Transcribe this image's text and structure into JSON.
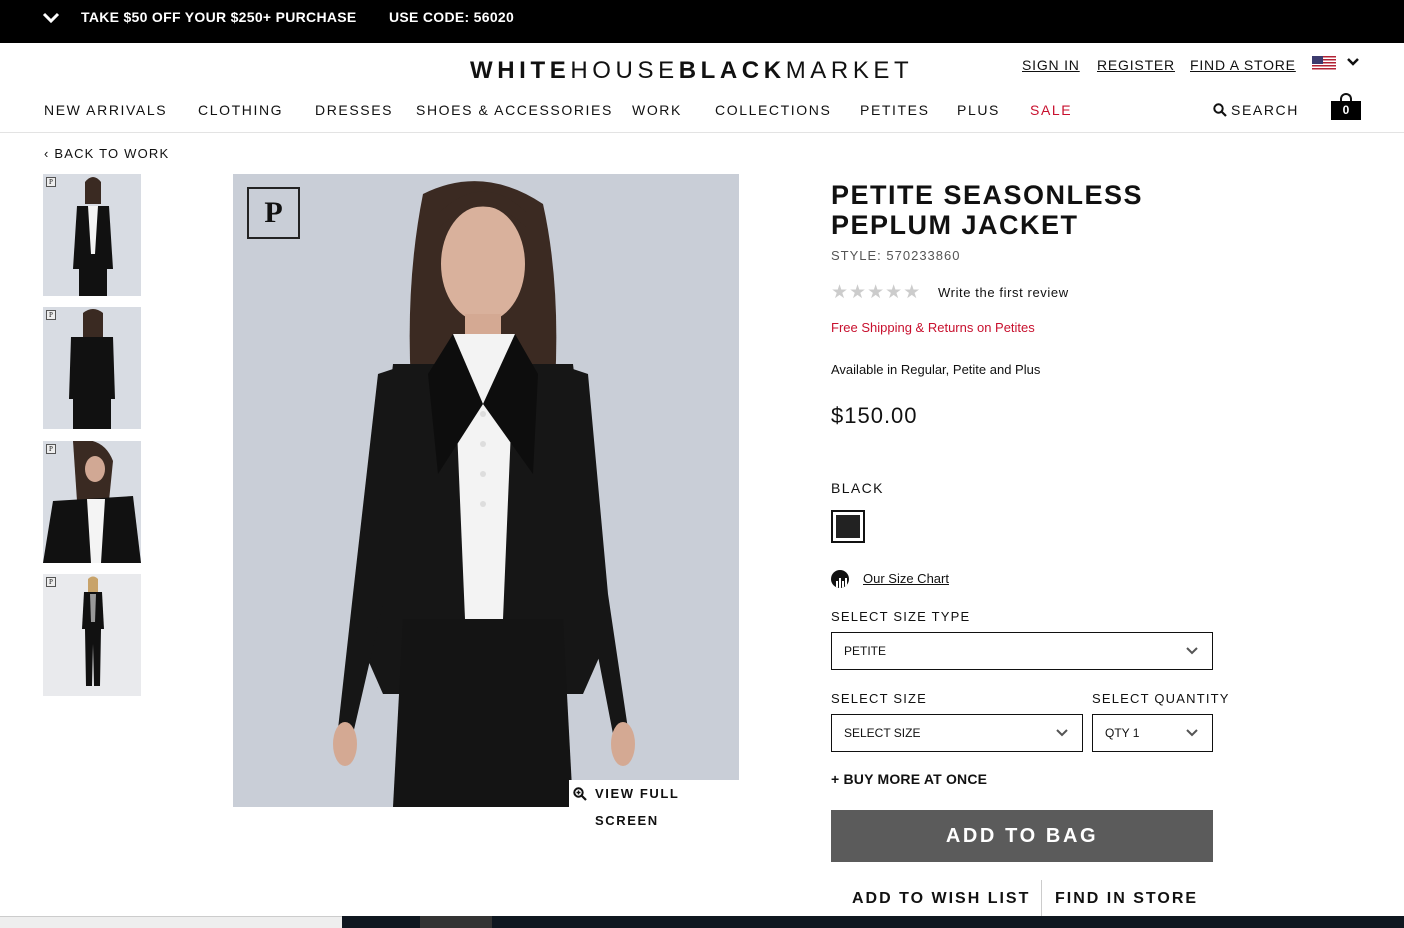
{
  "promo": {
    "offer": "TAKE $50 OFF YOUR $250+ PURCHASE",
    "code": "USE CODE: 56020",
    "toggle_icon": "chevron-down-icon"
  },
  "header": {
    "logo_white": "WHITE",
    "logo_house": "HOUSE",
    "logo_black": "BLACK",
    "logo_market": "MARKET",
    "sign_in": "SIGN IN",
    "register": "REGISTER",
    "find_store": "FIND A STORE",
    "country_icon": "us-flag-icon",
    "search": "SEARCH",
    "bag_count": "0"
  },
  "nav": [
    {
      "label": "NEW ARRIVALS"
    },
    {
      "label": "CLOTHING"
    },
    {
      "label": "DRESSES"
    },
    {
      "label": "SHOES & ACCESSORIES"
    },
    {
      "label": "WORK"
    },
    {
      "label": "COLLECTIONS"
    },
    {
      "label": "PETITES"
    },
    {
      "label": "PLUS"
    },
    {
      "label": "SALE",
      "color": "#c8102e"
    }
  ],
  "breadcrumb": {
    "back": "BACK TO WORK"
  },
  "gallery": {
    "badge": "P",
    "view_full_screen": "VIEW FULL SCREEN",
    "thumbnails": [
      {
        "badge": "P"
      },
      {
        "badge": "P"
      },
      {
        "badge": "P"
      },
      {
        "badge": "P"
      }
    ]
  },
  "product": {
    "title": "PETITE SEASONLESS PEPLUM JACKET",
    "style": "STYLE: 570233860",
    "rating": 0,
    "rating_max": 5,
    "review_link": "Write the first review",
    "free_shipping": "Free Shipping & Returns on Petites",
    "availability": "Available in Regular, Petite and Plus",
    "price": "$150.00",
    "color_name": "BLACK",
    "swatch_color": "#222222",
    "size_chart": "Our Size Chart",
    "size_type_label": "SELECT SIZE TYPE",
    "size_type_value": "PETITE",
    "size_label": "SELECT SIZE",
    "size_value": "SELECT SIZE",
    "quantity_label": "SELECT QUANTITY",
    "quantity_value": "QTY 1",
    "buy_more": "+ BUY MORE AT ONCE",
    "add_to_bag": "ADD TO BAG",
    "add_to_wish_list": "ADD TO WISH LIST",
    "find_in_store": "FIND IN STORE"
  }
}
